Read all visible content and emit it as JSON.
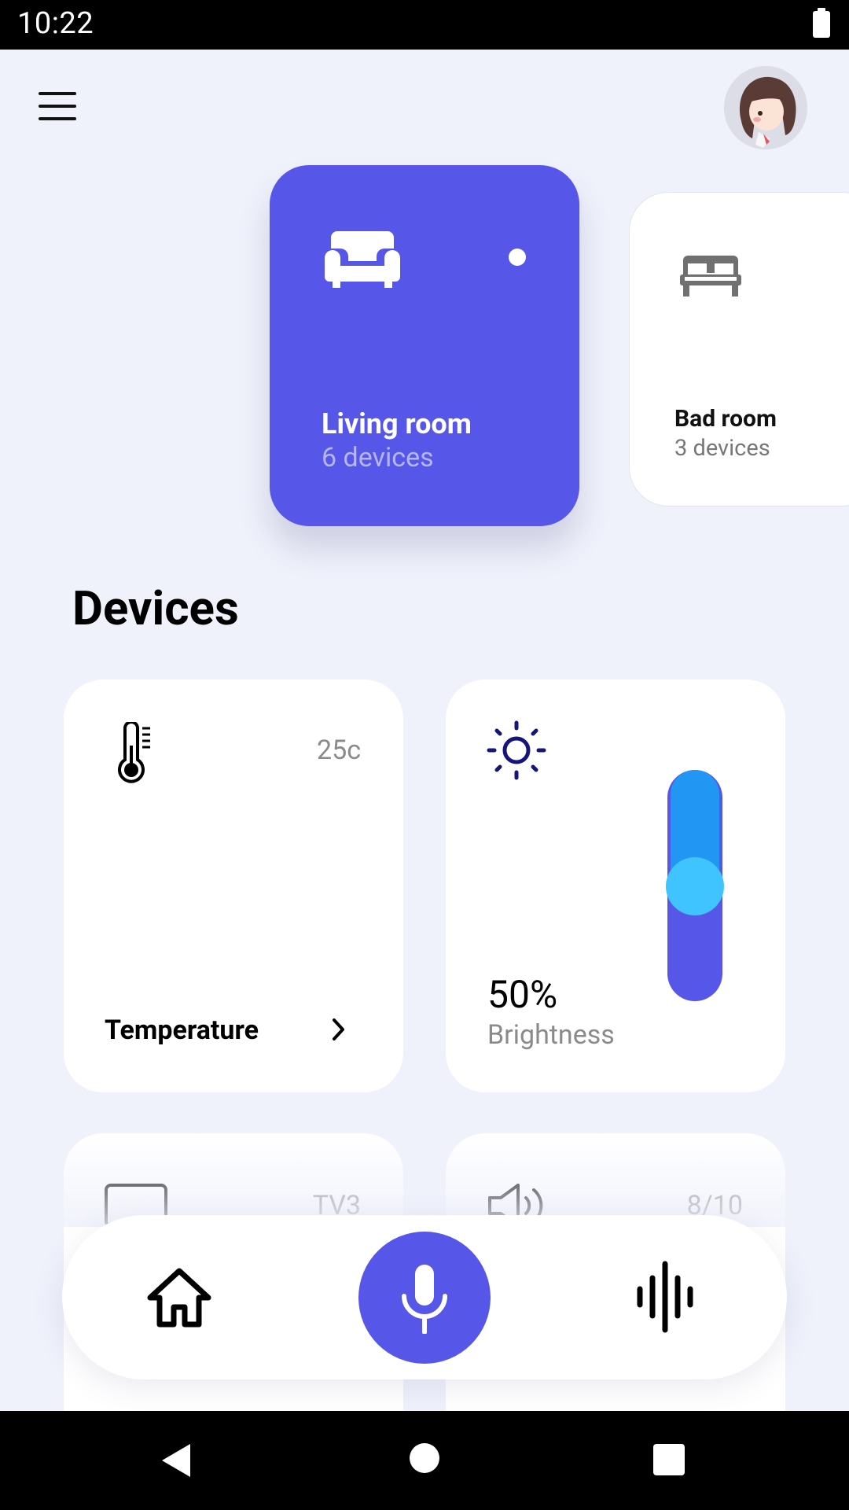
{
  "status_bar": {
    "time": "10:22"
  },
  "rooms": [
    {
      "name": "Living room",
      "devices": "6 devices",
      "icon": "sofa-icon",
      "active": true
    },
    {
      "name": "Bad room",
      "devices": "3 devices",
      "icon": "bed-icon",
      "active": false
    }
  ],
  "section_title": "Devices",
  "devices": {
    "temperature": {
      "label": "Temperature",
      "value": "25c",
      "icon": "thermometer-icon"
    },
    "brightness": {
      "label": "Brightness",
      "value": "50%",
      "level": 0.5,
      "icon": "sun-icon"
    },
    "tv": {
      "value": "TV3",
      "icon": "tv-icon"
    },
    "speaker": {
      "value": "8/10",
      "icon": "speaker-icon"
    }
  },
  "bottom_nav": {
    "items": [
      "home-icon",
      "microphone-icon",
      "sound-wave-icon"
    ]
  },
  "colors": {
    "accent": "#5656e9",
    "background": "#eff1fb",
    "slider_top": "#2196f3",
    "slider_knob": "#40c4ff"
  }
}
